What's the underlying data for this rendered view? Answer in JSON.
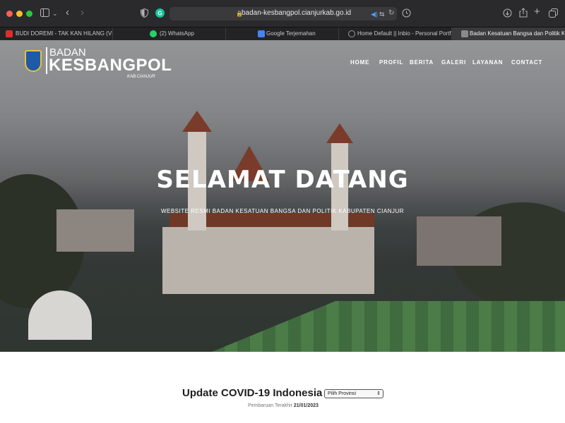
{
  "browser": {
    "url": "badan-kesbangpol.cianjurkab.go.id",
    "tabs": [
      {
        "label": "BUDI DOREMI - TAK KAN HILANG (VIDI...",
        "icon": "youtube-icon",
        "color": "#e32b2b"
      },
      {
        "label": "(2) WhatsApp",
        "icon": "whatsapp-icon",
        "color": "#25d366"
      },
      {
        "label": "Google Terjemahan",
        "icon": "translate-icon",
        "color": "#4285f4"
      },
      {
        "label": "Home Default || Inbio - Personal Portfol...",
        "icon": "compass-icon",
        "color": "#9a9a9a"
      },
      {
        "label": "Badan Kesatuan Bangsa dan Politik Ka...",
        "icon": "site-icon",
        "color": "#8a8a8a"
      }
    ]
  },
  "site": {
    "logo": {
      "line1": "BADAN",
      "line2": "KESBANGPOL",
      "line3": "KAB.CIANJUR"
    },
    "nav": [
      "HOME",
      "PROFIL",
      "BERITA",
      "GALERI",
      "LAYANAN",
      "CONTACT"
    ],
    "hero": {
      "title": "SELAMAT DATANG",
      "subtitle": "WEBSITE RESMI BADAN KESATUAN BANGSA DAN POLITIK KABUPATEN CIANJUR"
    },
    "covid": {
      "title": "Update COVID-19 Indonesia",
      "select": "Pilih Provinsi",
      "updated_label": "Pembaruan Terakhir",
      "updated_date": "21/01/2023"
    }
  },
  "colors": {
    "accent_logo_gold": "#e2c23f",
    "logo_blue": "#1f5aa6"
  }
}
